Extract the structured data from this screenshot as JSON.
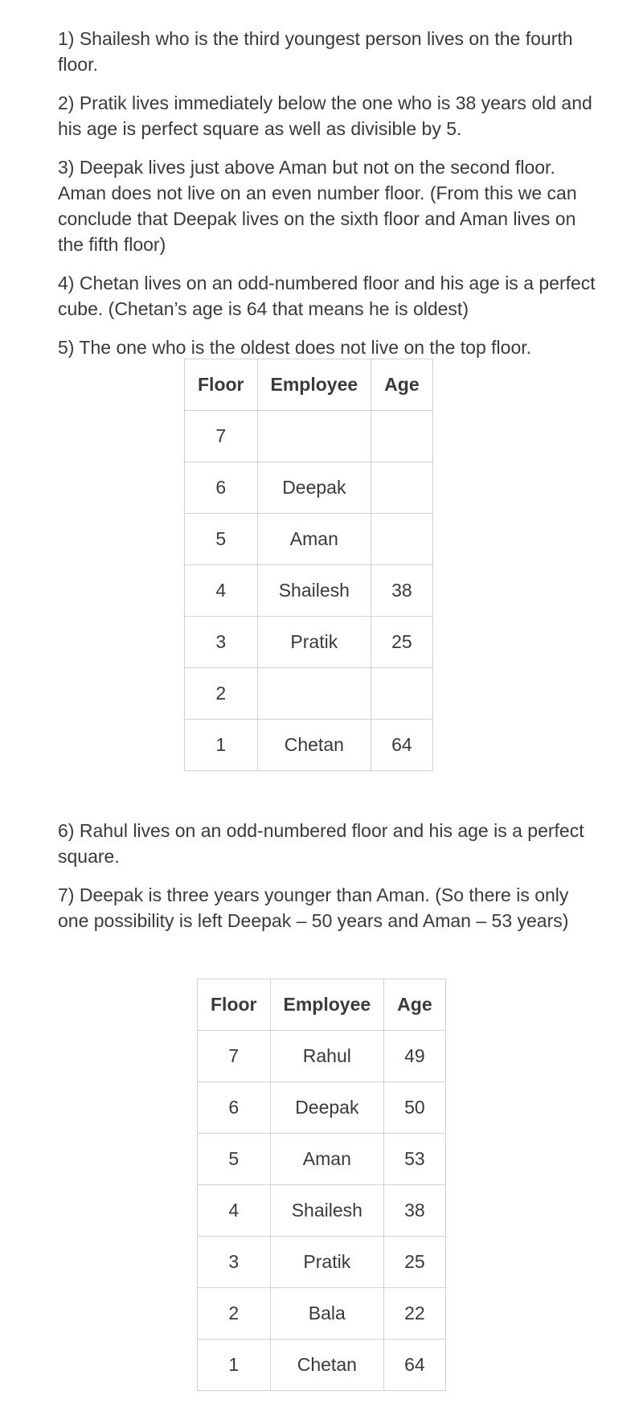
{
  "clues_top": [
    "1) Shailesh who is the third youngest person lives on the fourth floor.",
    "2) Pratik lives immediately below the one who is 38 years old and his age is perfect square as well as divisible by 5.",
    "3) Deepak lives just above Aman but not on the second floor. Aman does not live on an even number floor. (From this we can conclude that Deepak lives on the sixth floor and Aman lives on the fifth floor)",
    "4) Chetan lives on an odd-numbered floor and his age is a perfect cube. (Chetan’s age is 64 that means he is oldest)",
    "5) The one who is the oldest does not live on the top floor."
  ],
  "table1": {
    "headers": [
      "Floor",
      "Employee",
      "Age"
    ],
    "rows": [
      [
        "7",
        "",
        ""
      ],
      [
        "6",
        "Deepak",
        ""
      ],
      [
        "5",
        "Aman",
        ""
      ],
      [
        "4",
        "Shailesh",
        "38"
      ],
      [
        "3",
        "Pratik",
        "25"
      ],
      [
        "2",
        "",
        ""
      ],
      [
        "1",
        "Chetan",
        "64"
      ]
    ]
  },
  "clues_bottom": [
    "6) Rahul lives on an odd-numbered floor and his age is a perfect square.",
    "7) Deepak is three years younger than Aman. (So there is only one possibility is left Deepak – 50 years and Aman – 53 years)"
  ],
  "table2": {
    "headers": [
      "Floor",
      "Employee",
      "Age"
    ],
    "rows": [
      [
        "7",
        "Rahul",
        "49"
      ],
      [
        "6",
        "Deepak",
        "50"
      ],
      [
        "5",
        "Aman",
        "53"
      ],
      [
        "4",
        "Shailesh",
        "38"
      ],
      [
        "3",
        "Pratik",
        "25"
      ],
      [
        "2",
        "Bala",
        "22"
      ],
      [
        "1",
        "Chetan",
        "64"
      ]
    ]
  }
}
